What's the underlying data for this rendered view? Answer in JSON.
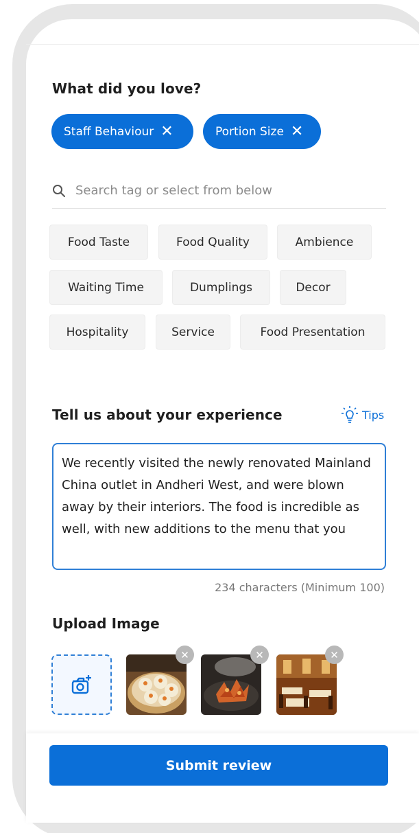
{
  "love_section": {
    "title": "What did you love?",
    "selected_tags": [
      "Staff Behaviour",
      "Portion Size"
    ],
    "remove_glyph": "✕",
    "search_placeholder": "Search tag or select from below",
    "tags": [
      "Food Taste",
      "Food Quality",
      "Ambience",
      "Waiting Time",
      "Dumplings",
      "Decor",
      "Hospitality",
      "Service",
      "Food Presentation"
    ]
  },
  "experience_section": {
    "title": "Tell us about your experience",
    "tips_label": "Tips",
    "review_text": "We recently visited the newly renovated Mainland China outlet in Andheri West, and were blown away by their interiors. The food is incredible as well, with new additions to the menu that you",
    "char_count": "234 characters (Minimum 100)"
  },
  "upload_section": {
    "title": "Upload Image",
    "images": [
      "dim-sum-photo",
      "chili-dish-photo",
      "restaurant-interior-photo"
    ]
  },
  "footer": {
    "submit_label": "Submit review"
  },
  "colors": {
    "primary": "#0b6fd8",
    "border_focus": "#2f7fd6",
    "tag_bg": "#f4f4f4"
  }
}
